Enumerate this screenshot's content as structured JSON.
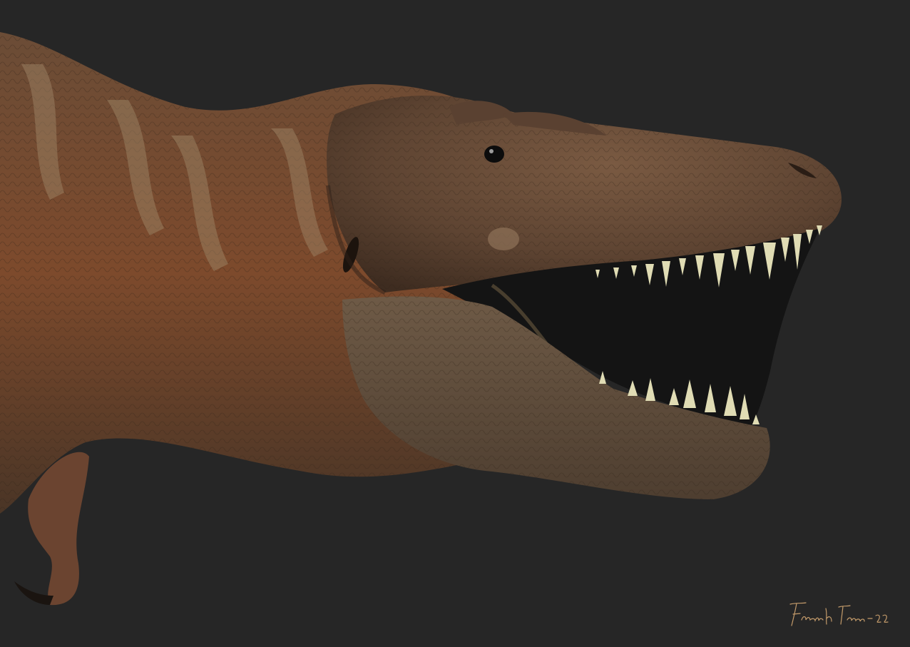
{
  "artwork": {
    "subject": "tyrannosaur-head-and-neck",
    "signature_text": "Frank Forte -22",
    "colors": {
      "background": "#262626",
      "skin_dark": "#4a3526",
      "skin_mid": "#6b4c36",
      "skin_light": "#8a6a4f",
      "skin_rust": "#7d4a2c",
      "stripe": "#a18a6a",
      "mouth": "#141414",
      "teeth": "#e0dcb4",
      "eye": "#0c0c0c",
      "signature": "#c29a6a"
    }
  }
}
